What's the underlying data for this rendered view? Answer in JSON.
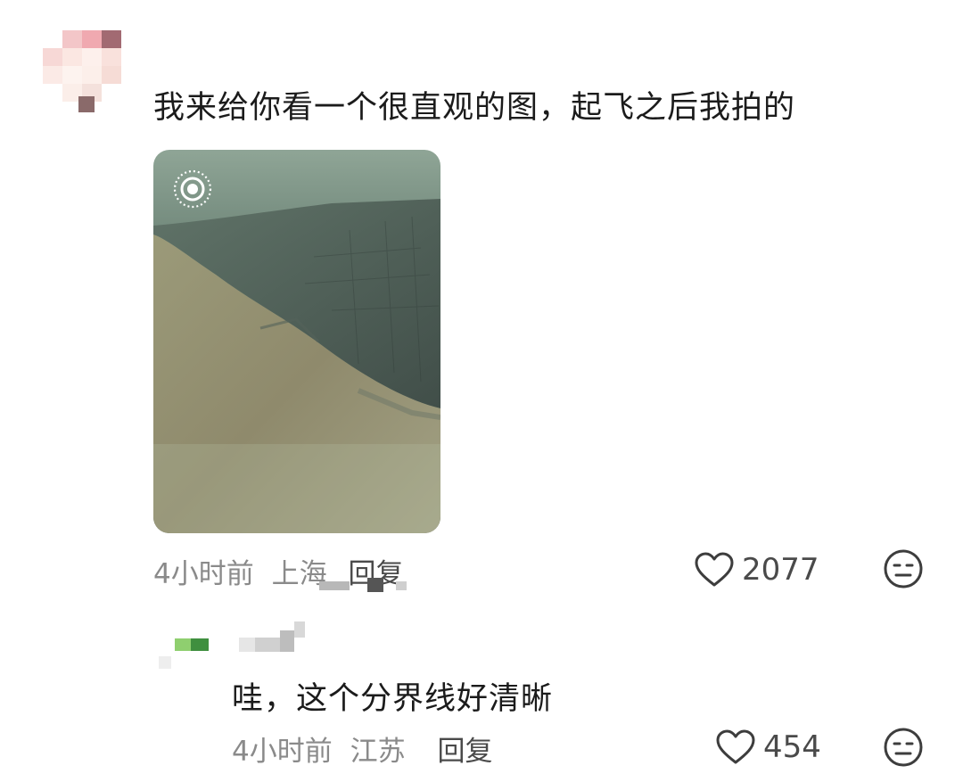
{
  "comments": [
    {
      "text": "我来给你看一个很直观的图，起飞之后我拍的",
      "time": "4小时前",
      "location": "上海",
      "reply_label": "回复",
      "likes": "2077",
      "has_photo": true,
      "photo_badge_icon": "live-photo-icon"
    },
    {
      "text": "哇，这个分界线好清晰",
      "time": "4小时前",
      "location": "江苏",
      "reply_label": "回复",
      "likes": "454"
    }
  ],
  "icons": {
    "like": "heart-outline-icon",
    "dislike": "meh-face-icon"
  },
  "colors": {
    "text_primary": "#1b1b1b",
    "text_meta": "#8a8a8a",
    "icon": "#4a4a4a"
  }
}
